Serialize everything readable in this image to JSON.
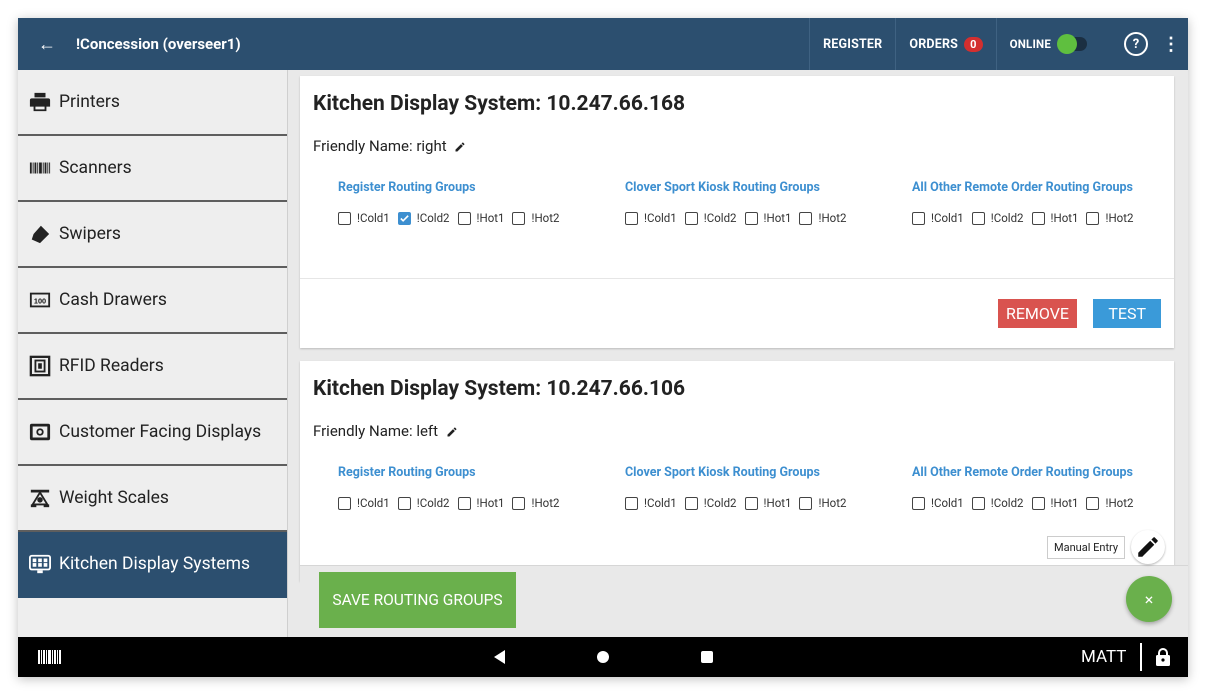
{
  "appbar": {
    "back_icon": "arrow-left-icon",
    "title": "!Concession (overseer1)",
    "register_label": "REGISTER",
    "orders_label": "ORDERS",
    "orders_count": "0",
    "online_label": "ONLINE",
    "online_on": true,
    "help_label": "?",
    "menu_label": "⋮"
  },
  "sidebar": {
    "items": [
      {
        "label": "Printers",
        "icon": "printer-icon"
      },
      {
        "label": "Scanners",
        "icon": "barcode-icon"
      },
      {
        "label": "Swipers",
        "icon": "swiper-icon"
      },
      {
        "label": "Cash Drawers",
        "icon": "cash-drawer-icon"
      },
      {
        "label": "RFID Readers",
        "icon": "rfid-icon"
      },
      {
        "label": "Customer Facing Displays",
        "icon": "display-icon"
      },
      {
        "label": "Weight Scales",
        "icon": "scale-icon"
      },
      {
        "label": "Kitchen Display Systems",
        "icon": "kitchen-display-icon",
        "active": true
      }
    ]
  },
  "group_titles": {
    "register": "Register Routing Groups",
    "kiosk": "Clover Sport Kiosk Routing Groups",
    "remote": "All Other Remote Order Routing Groups"
  },
  "options": [
    "!Cold1",
    "!Cold2",
    "!Hot1",
    "!Hot2"
  ],
  "cards": [
    {
      "title": "Kitchen Display System: 10.247.66.168",
      "friendly_name": "Friendly Name: right",
      "register_checked": [
        false,
        true,
        false,
        false
      ],
      "kiosk_checked": [
        false,
        false,
        false,
        false
      ],
      "remote_checked": [
        false,
        false,
        false,
        false
      ],
      "remove_label": "REMOVE",
      "test_label": "TEST"
    },
    {
      "title": "Kitchen Display System: 10.247.66.106",
      "friendly_name": "Friendly Name: left",
      "register_checked": [
        false,
        false,
        false,
        false
      ],
      "kiosk_checked": [
        false,
        false,
        false,
        false
      ],
      "remote_checked": [
        false,
        false,
        false,
        false
      ]
    }
  ],
  "save_label": "SAVE ROUTING GROUPS",
  "manual_entry_label": "Manual Entry",
  "fab_close_label": "×",
  "navbar": {
    "user": "MATT"
  },
  "colors": {
    "appbar": "#2c4f6f",
    "accent_blue": "#3d8fd0",
    "remove_red": "#d9534f",
    "test_blue": "#3a9ad9",
    "save_green": "#6ab04c"
  }
}
